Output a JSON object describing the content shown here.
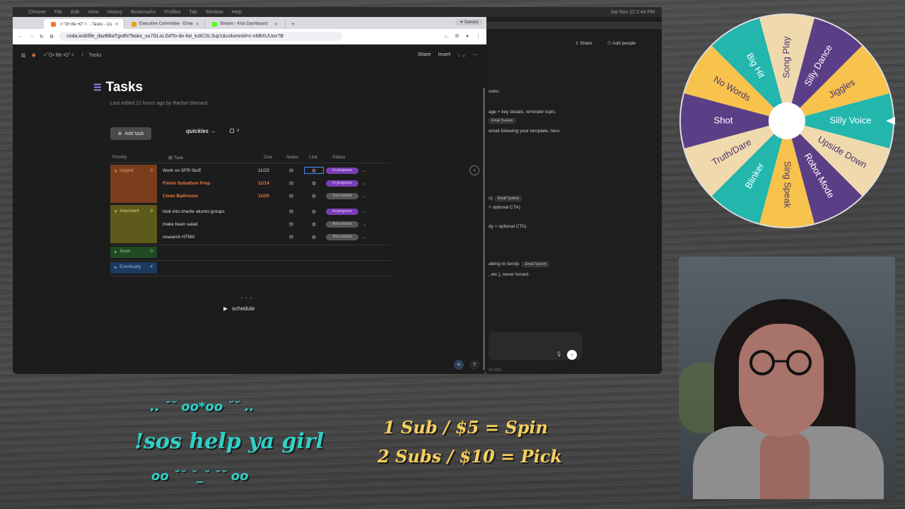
{
  "menubar": {
    "items": [
      "Chrome",
      "File",
      "Edit",
      "View",
      "History",
      "Bookmarks",
      "Profiles",
      "Tab",
      "Window",
      "Help"
    ],
    "clock": "Sat Nov 22 2:44 PM"
  },
  "browser": {
    "tabs": [
      {
        "label": ".✧˚O• life •O˚✧. - Tasks - Co",
        "color": "#f07a3a",
        "active": true
      },
      {
        "label": "Executive Committee - Emai",
        "color": "#e8a317",
        "active": false
      },
      {
        "label": "Stream - Kick Dashboard",
        "color": "#53fc18",
        "active": false
      }
    ],
    "new_tab": "+",
    "gemini": "✦ Gemini",
    "url": "coda.io/d/life_dazBBaTgv8h/Tasks_su7GLoLG#To-do-list_tu9CSLSujr1&columnId=c-n6BXUUov7B"
  },
  "coda": {
    "breadcrumb_doc": ".✧˚O• life •O˚✧.",
    "breadcrumb_page": "Tasks",
    "share": "Share",
    "insert": "Insert",
    "title": "Tasks",
    "edited": "Last edited 21 hours ago by Rachel Sherard.",
    "add_task": "Add task",
    "quickies": "quickies →",
    "quickies_check": "x",
    "columns": {
      "priority": "Priority",
      "task": "Task",
      "due": "Due",
      "notes": "Notes",
      "link": "Link",
      "status": "Status"
    },
    "groups": [
      {
        "name": "Urgent",
        "count": "3",
        "color": "#7a3e1d",
        "text": "#f0a070"
      },
      {
        "name": "Important",
        "count": "3",
        "color": "#5e5a1c",
        "text": "#e2d37a"
      },
      {
        "name": "Soon",
        "count": "0",
        "color": "#1f4a22",
        "text": "#8fd68f"
      },
      {
        "name": "Eventually",
        "count": "4",
        "color": "#1d3a5e",
        "text": "#8fb8e6"
      }
    ],
    "rows": [
      {
        "task": "Work on SFR Stuff",
        "due": "11/23",
        "status": "In progress"
      },
      {
        "task": "Finish Subathon Prep",
        "due": "11/14",
        "status": "In progress"
      },
      {
        "task": "Clean Bathroom",
        "due": "11/20",
        "status": "Not started"
      },
      {
        "task": "look into charlie alumni groups",
        "due": "",
        "status": "In progress"
      },
      {
        "task": "make bean salad",
        "due": "",
        "status": "Not started"
      },
      {
        "task": "research HTMX",
        "due": "",
        "status": "Not started"
      }
    ],
    "schedule": "schedule"
  },
  "gemini_window": {
    "share": "Share",
    "add_people": "Add people",
    "lines": [
      "rules:",
      "age + key details, reminder topic,",
      "email following your template, hero",
      "o)",
      "+ optional CTA)",
      "dy + optional CTA)",
      "alking to family.",
      ", etc.), never forced.",
      "nt info."
    ],
    "chip": "Email System"
  },
  "wheel": {
    "segments": [
      "Song Play",
      "Silly Dance",
      "Jiggles",
      "Silly Voice",
      "Upside Down",
      "Robot Mode",
      "Sing Speak",
      "Blinker",
      "Truth/Dare",
      "Shot",
      "No Words",
      "Big Hit"
    ],
    "colors": [
      "#f0d9ac",
      "#5b3f86",
      "#f7c34d",
      "#22b6ad",
      "#f0d9ac",
      "#5b3f86",
      "#f7c34d",
      "#22b6ad",
      "#f0d9ac",
      "#5b3f86",
      "#f7c34d",
      "#22b6ad"
    ]
  },
  "overlay": {
    "kaomoji_top": ".. ˘˘ oo*oo ˘˘ ..",
    "command": "!sos help ya girl",
    "kaomoji_bottom": "oo ˘˘ ˘_˘ ˘˘ oo",
    "sub_line1": "1 Sub / $5 = Spin",
    "sub_line2": "2 Subs / $10 = Pick"
  }
}
